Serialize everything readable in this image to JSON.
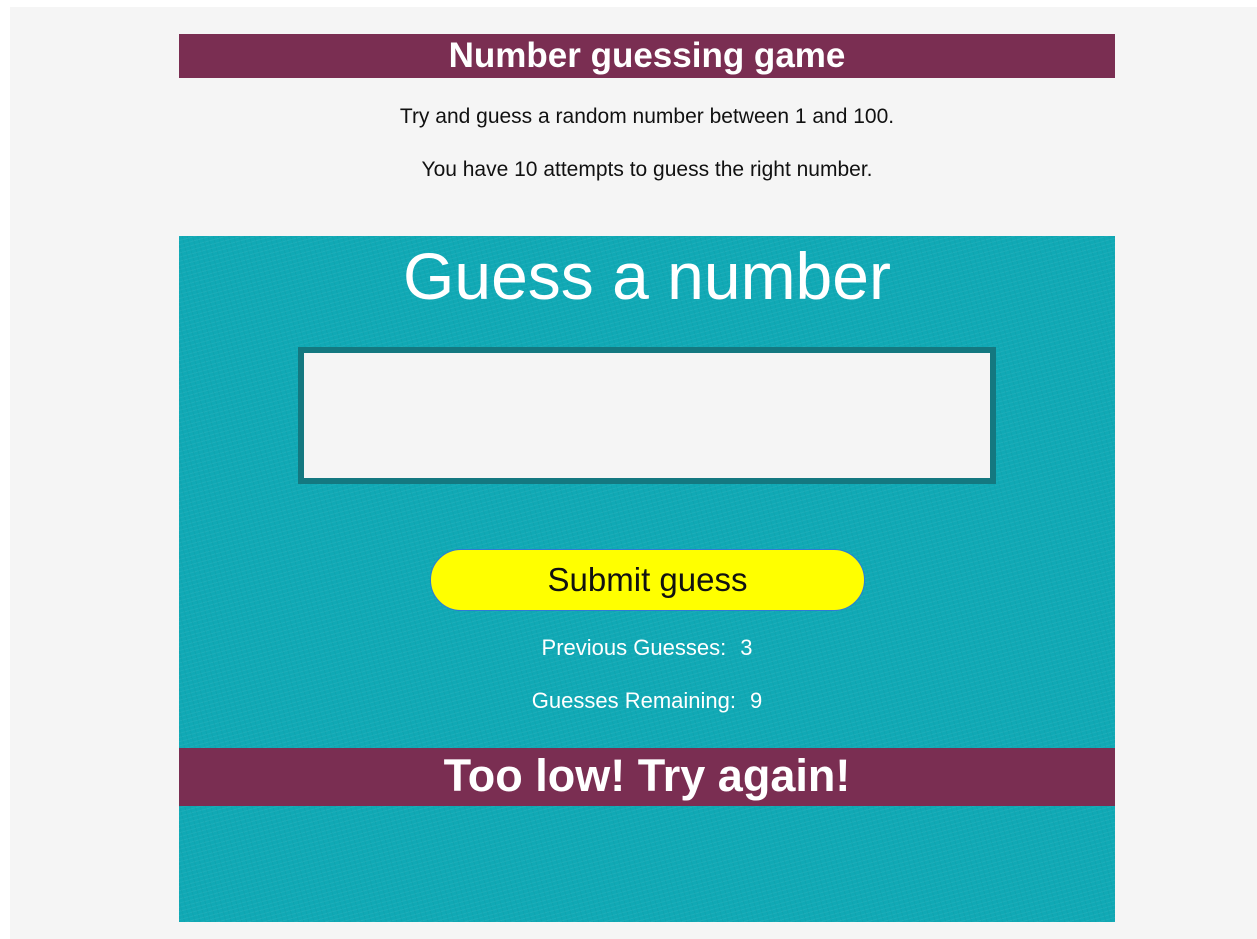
{
  "header": {
    "title": "Number guessing game"
  },
  "intro": {
    "line1": "Try and guess a random number between 1 and 100.",
    "line2": "You have 10 attempts to guess the right number."
  },
  "game": {
    "heading": "Guess a number",
    "input_value": "",
    "submit_label": "Submit guess",
    "previous_label": "Previous Guesses:",
    "previous_value": "3",
    "remaining_label": "Guesses Remaining:",
    "remaining_value": "9",
    "feedback": "Too low! Try again!"
  },
  "colors": {
    "title_bar": "#7a2e52",
    "panel": "#10a9b5",
    "button": "#ffff00",
    "input_border": "#147880"
  }
}
